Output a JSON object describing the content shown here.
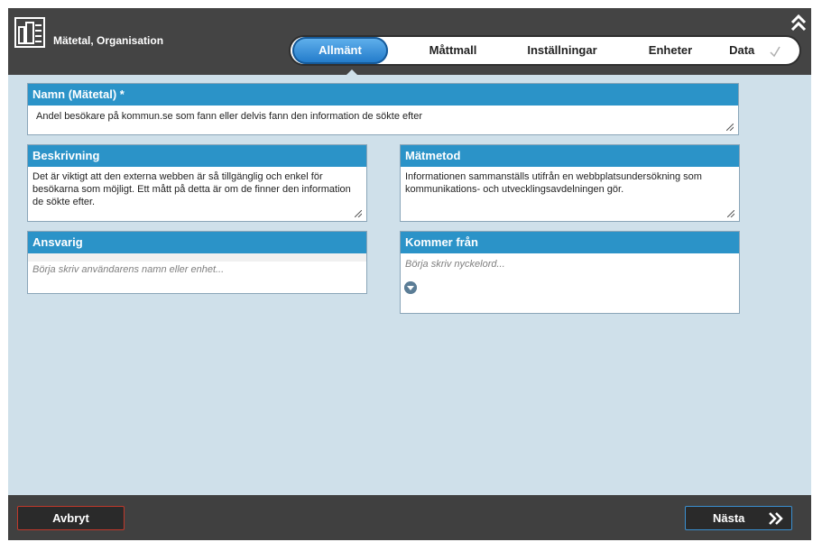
{
  "header": {
    "title": "Mätetal, Organisation",
    "icon": "chart-icon",
    "collapse_icon": "double-chevron-up-icon"
  },
  "tabs": [
    {
      "label": "Allmänt",
      "active": true
    },
    {
      "label": "Måttmall",
      "active": false
    },
    {
      "label": "Inställningar",
      "active": false
    },
    {
      "label": "Enheter",
      "active": false
    },
    {
      "label": "Data",
      "active": false
    }
  ],
  "form": {
    "name": {
      "label": "Namn (Mätetal) *",
      "value": "Andel besökare på kommun.se som fann eller delvis fann den information de sökte efter"
    },
    "description": {
      "label": "Beskrivning",
      "value": "Det är viktigt att den externa webben är så tillgänglig och enkel för besökarna som möjligt. Ett mått på detta är om de finner den information de sökte efter."
    },
    "method": {
      "label": "Mätmetod",
      "value": "Informationen sammanställs utifrån en webbplatsundersökning som kommunikations- och utvecklingsavdelningen gör."
    },
    "responsible": {
      "label": "Ansvarig",
      "placeholder": "Börja skriv användarens namn eller enhet..."
    },
    "source": {
      "label": "Kommer från",
      "placeholder": "Börja skriv nyckelord..."
    }
  },
  "footer": {
    "cancel_label": "Avbryt",
    "next_label": "Nästa"
  },
  "colors": {
    "accent": "#2b93c8",
    "background": "#cfe0ea",
    "chrome": "#404040",
    "cancel_border": "#c0392b",
    "next_border": "#3a8fd0"
  }
}
